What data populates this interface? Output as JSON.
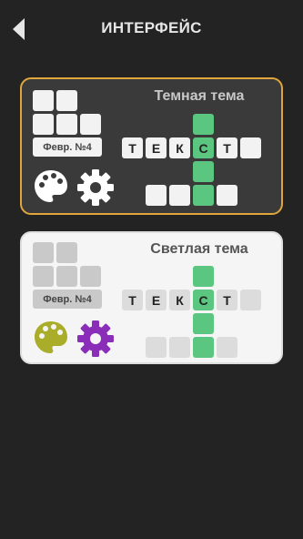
{
  "header": {
    "title": "ИНТЕРФЕЙС"
  },
  "dark_theme": {
    "title": "Темная тема",
    "date_label": "Февр. №4",
    "word": [
      "Т",
      "Е",
      "К",
      "С",
      "Т"
    ]
  },
  "light_theme": {
    "title": "Светлая тема",
    "date_label": "Февр. №4",
    "word": [
      "Т",
      "Е",
      "К",
      "С",
      "Т"
    ]
  },
  "colors": {
    "background": "#232323",
    "dark_card": "#3a3a3a",
    "dark_card_border": "#e0a63b",
    "light_card": "#f5f5f5",
    "highlight_green": "#5bc67f",
    "palette_olive": "#a9ad2a",
    "gear_purple": "#8a2db8"
  },
  "icons": [
    "back-arrow-icon",
    "palette-icon",
    "gear-icon"
  ]
}
